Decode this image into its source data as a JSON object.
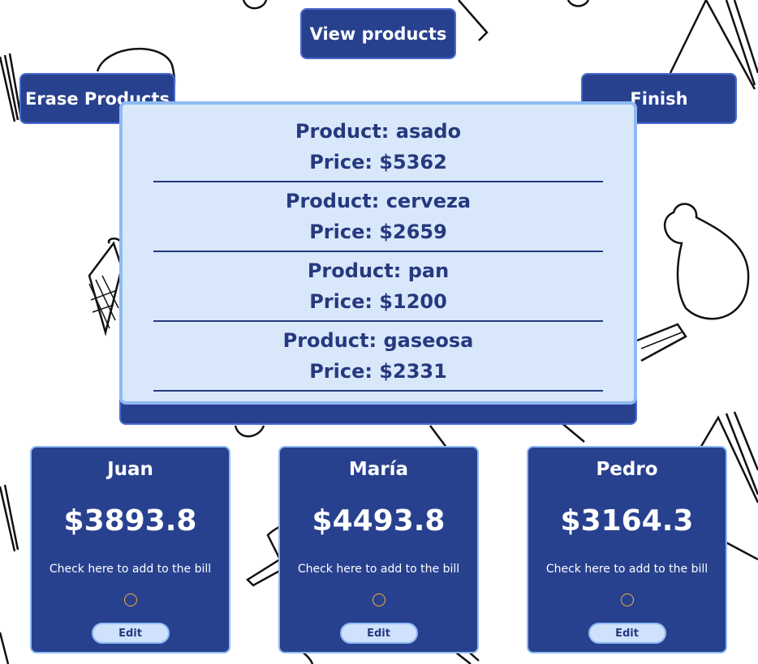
{
  "toolbar": {
    "view_products_label": "View products",
    "erase_products_label": "Erase Products",
    "finish_label": "Finish"
  },
  "products_modal": {
    "product_prefix": "Product: ",
    "price_prefix": "Price: $",
    "items": [
      {
        "name": "asado",
        "price": "5362"
      },
      {
        "name": "cerveza",
        "price": "2659"
      },
      {
        "name": "pan",
        "price": "1200"
      },
      {
        "name": "gaseosa",
        "price": "2331"
      }
    ]
  },
  "people": [
    {
      "name": "Juan",
      "total": "$3893.8",
      "check_hint": "Check here to add to the bill",
      "edit_label": "Edit"
    },
    {
      "name": "María",
      "total": "$4493.8",
      "check_hint": "Check here to add to the bill",
      "edit_label": "Edit"
    },
    {
      "name": "Pedro",
      "total": "$3164.3",
      "check_hint": "Check here to add to the bill",
      "edit_label": "Edit"
    }
  ],
  "colors": {
    "primary": "#28418f",
    "modal_bg": "#d9e7fb",
    "modal_border": "#8ebaf2",
    "text_dark": "#26397e",
    "checkbox_ring": "#f2b233"
  }
}
